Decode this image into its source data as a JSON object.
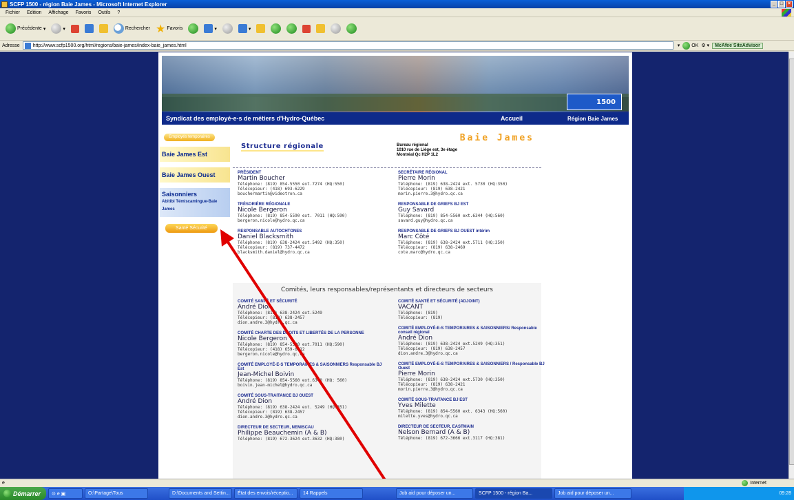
{
  "window": {
    "title": "SCFP 1500 - région Baie James - Microsoft Internet Explorer"
  },
  "menu": [
    "Fichier",
    "Edition",
    "Affichage",
    "Favoris",
    "Outils",
    "?"
  ],
  "toolbar": {
    "back": "Précédente",
    "search": "Rechercher",
    "favorites": "Favoris"
  },
  "address": {
    "label": "Adresse",
    "url": "http://www.scfp1500.org/html/regions/baie-james/index-baie_james.html",
    "go": "OK",
    "mcafee": "McAfee SiteAdvisor"
  },
  "banner": {
    "union": "Syndicat des employé-e-s de métiers d'Hydro-Québec",
    "home": "Accueil",
    "region": "Région Baie James",
    "logo": "1500"
  },
  "sidebar": {
    "temp_pill": "Employés temporaires",
    "items": [
      "Baie James Est",
      "Baie James Ouest"
    ],
    "seasonal": "Saisonniers",
    "seasonal_sub": "Abitibi Témiscamingue-Baie James",
    "sante": "Santé Sécurité"
  },
  "content": {
    "structure_title": "Structure régionale",
    "region_title": "Baie James",
    "bureau": [
      "Bureau régional",
      "1010 rue de Liège est, 3e étage",
      "Montréal Qc H2P 1L2"
    ],
    "left": [
      {
        "role": "PRÉSIDENT",
        "name": "Martin Boucher",
        "lines": [
          "Téléphone: (819) 854-5550 ext.7274 (HQ:550)",
          "Télécopieur: (418) 693-6229",
          "bouchermartin@videotron.ca"
        ]
      },
      {
        "role": "TRÉSORIÈRE RÉGIONALE",
        "name": "Nicole Bergeron",
        "lines": [
          "Téléphone: (819) 854-5590 ext. 7011 (HQ:590)",
          "bergeron.nicole@hydro.qc.ca"
        ]
      },
      {
        "role": "RESPONSABLE AUTOCHTONES",
        "name": "Daniel Blacksmith",
        "lines": [
          "Téléphone: (819) 638-2424 ext.5492 (HQ:350)",
          "Télécopieur: (819) 737-4472",
          "blacksmith.daniel@hydro.qc.ca"
        ]
      }
    ],
    "right": [
      {
        "role": "SECRÉTAIRE RÉGIONAL",
        "name": "Pierre Morin",
        "lines": [
          "Téléphone: (819) 638-2424 ext. 5730 (HQ:350)",
          "Télécopieur: (819) 638-2421",
          "morin.pierre.3@hydro.qc.ca"
        ]
      },
      {
        "role": "RESPONSABLE DE GRIEFS BJ EST",
        "name": "Guy Savard",
        "lines": [
          "Téléphone: (819) 854-5560 ext.6344 (HQ:560)",
          "savard.guy@hydro.qc.ca"
        ]
      },
      {
        "role": "RESPONSABLE DE GRIEFS BJ OUEST intérim",
        "name": "Marc Côté",
        "lines": [
          "Téléphone: (819) 638-2424 ext.5711 (HQ:350)",
          "Télécopieur: (819) 638-2469",
          "cote.marc@hydro.qc.ca"
        ]
      }
    ],
    "comites_title": "Comités, leurs responsables/représentants et directeurs de secteurs",
    "comites_left": [
      {
        "role": "COMITÉ SANTÉ ET SÉCURITÉ",
        "name": "André Dion",
        "lines": [
          "Téléphone: (819) 638-2424 ext.5249",
          "Télécopieur: (819) 638-2457",
          "dion.andre.3@hydro.qc.ca"
        ]
      },
      {
        "role": "COMITÉ CHARTE DES DROITS ET LIBERTÉS DE LA PERSONNE",
        "name": "Nicole Bergeron",
        "lines": [
          "Téléphone: (819) 854-5590 ext.7011 (HQ:590)",
          "Télécopieur: (418) 659-6112",
          "bergeron.nicole@hydro.qc.ca"
        ]
      },
      {
        "role": "COMITÉ EMPLOYÉ-E-S TEMPORAIRES & SAISONNIERS Responsable BJ Est",
        "name": "Jean-Michel Boivin",
        "lines": [
          "Téléphone: (819) 854-5560 ext.6340 (HQ: 560)",
          "boivin.jean-michel@hydro.qc.ca"
        ]
      },
      {
        "role": "COMITÉ SOUS-TRAITANCE BJ OUEST",
        "name": "André Dion",
        "lines": [
          "Téléphone: (819) 638-2424 ext. 5249 (HQ:351)",
          "Télécopieur: (819) 638-2457",
          "dion.andre.3@hydro.qc.ca"
        ]
      },
      {
        "role": "DIRECTEUR DE SECTEUR, NEMISCAU",
        "name": "Philippe Beauchemin (A & B)",
        "lines": [
          "Téléphone: (819) 672-3624 ext.3632 (HQ:380)"
        ]
      }
    ],
    "comites_right": [
      {
        "role": "COMITÉ SANTÉ ET SÉCURITÉ (ADJOINT)",
        "name": "VACANT",
        "lines": [
          "Téléphone: (819)",
          "Télécopieur: (819)"
        ]
      },
      {
        "role": "COMITÉ EMPLOYÉ-E-S TEMPORAIRES & SAISONNIERS/ Responsable conseil régional",
        "name": "André Dion",
        "lines": [
          "Téléphone: (819) 638-2424 ext.5249 (HQ:351)",
          "Télécopieur: (819) 638-2457",
          "dion.andre.3@hydro.qc.ca"
        ]
      },
      {
        "role": "COMITÉ EMPLOYÉ-E-S TEMPORAIRES & SAISONNIERS / Responsable BJ Ouest",
        "name": "Pierre Morin",
        "lines": [
          "Téléphone: (819) 638-2424 ext.5730 (HQ:350)",
          "Télécopieur: (819) 638-2421",
          "morin.pierre.3@hydro.qc.ca"
        ]
      },
      {
        "role": "COMITÉ SOUS-TRAITANCE BJ EST",
        "name": "Yves Milette",
        "lines": [
          "Téléphone: (819) 854-5560 ext. 6343 (HQ:560)",
          "milette.yves@hydro.qc.ca"
        ]
      },
      {
        "role": "DIRECTEUR DE SECTEUR, EASTMAIN",
        "name": "Nelson Bernard (A & B)",
        "lines": [
          "Téléphone: (819) 672-3666 ext.3117 (HQ:381)"
        ]
      }
    ]
  },
  "status": {
    "zone": "Internet"
  },
  "taskbar": {
    "start": "Démarrer",
    "tasks": [
      "O:\\Partage\\Tous",
      "D:\\Documents and Settin...",
      "État des envois/réceptio...",
      "14 Rappels",
      "Job aid pour déposer un...",
      "SCFP 1500 - région Ba...",
      "Job aid pour déposer un..."
    ],
    "clock": "09:28"
  },
  "colors": {
    "page_bg": "#14246e",
    "banner_strip": "#0e2a8a",
    "accent_orange": "#f0a020",
    "annotation_arrow": "#e00000"
  }
}
